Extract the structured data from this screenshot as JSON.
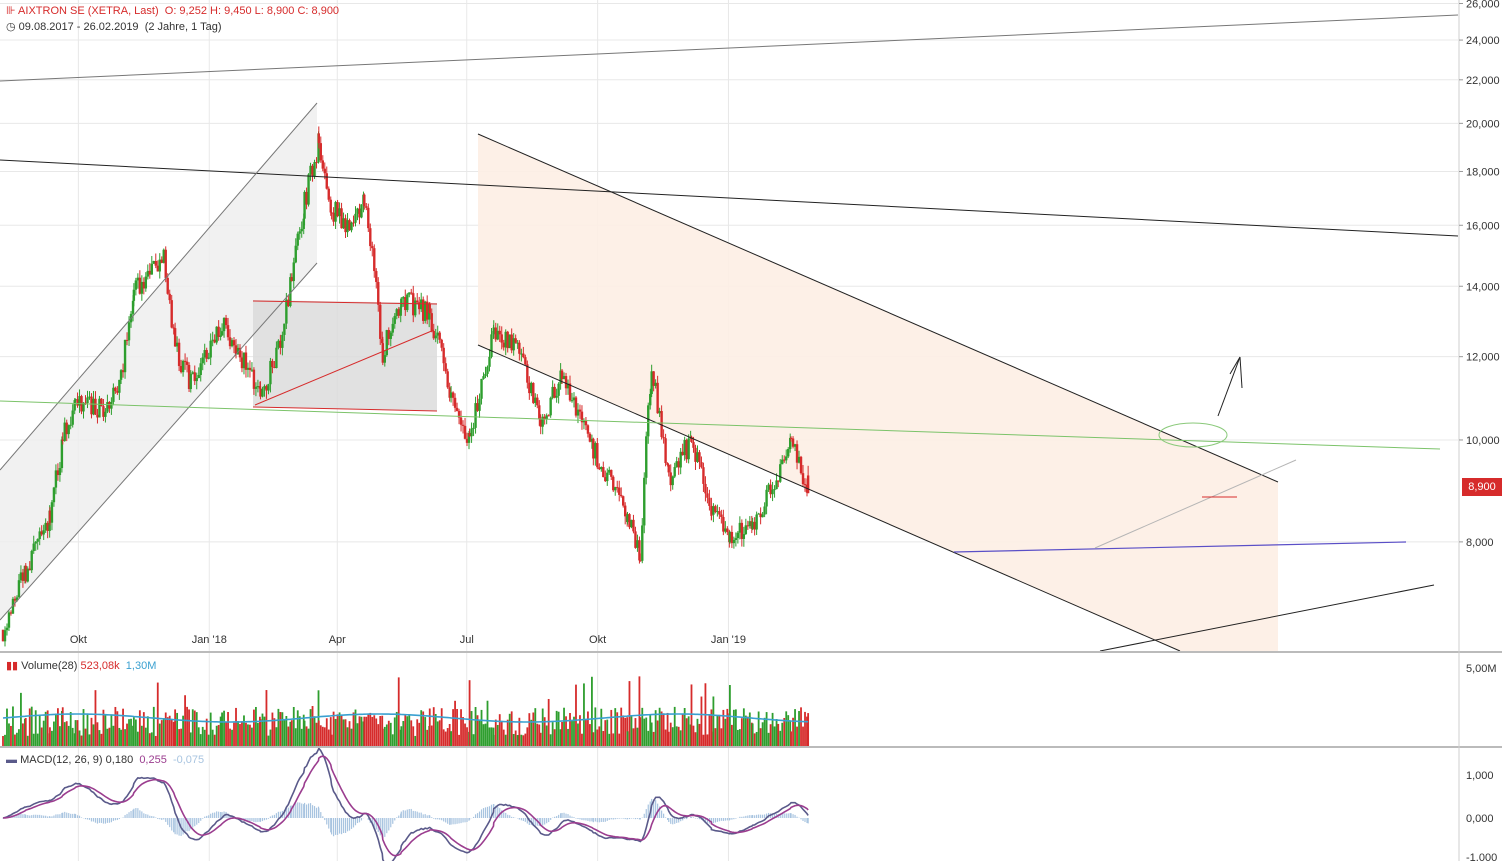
{
  "header": {
    "title": "AIXTRON SE (XETRA, Last)",
    "ohlc": "O: 9,252  H: 9,450  L: 8,900  C: 8,900",
    "range": "09.08.2017 - 26.02.2019",
    "range_note": "(2 Jahre, 1 Tag)"
  },
  "volume_legend": {
    "label": "Volume(28)",
    "value1": "523,08k",
    "value2": "1,30M"
  },
  "macd_legend": {
    "label": "MACD(12, 26, 9)",
    "macd": "0,180",
    "signal": "0,255",
    "hist": "-0,075"
  },
  "last_price_label": "8,900",
  "colors": {
    "up": "#2e9e2e",
    "down": "#d62b2b",
    "volume_ma": "#3aa0d0",
    "macd_line": "#5a5a8a",
    "signal_line": "#9b3d8f",
    "hist": "#a8c4e0",
    "channel_fill": "#fdeee4",
    "box_fill": "#d9d9d9"
  },
  "chart_data": {
    "type": "candlestick",
    "title": "AIXTRON SE (XETRA, Last)",
    "x_tick_labels": [
      "Okt",
      "Jan '18",
      "Apr",
      "Jul",
      "Okt",
      "Jan '19"
    ],
    "y_tick_labels": [
      "8,000",
      "10,000",
      "12,000",
      "14,000",
      "16,000",
      "18,000",
      "20,000",
      "22,000",
      "24,000",
      "26,000"
    ],
    "ylim": [
      6.3,
      26.2
    ],
    "y_scale": "log",
    "price_path": [
      {
        "date": "2017-08-09",
        "close": 6.6
      },
      {
        "date": "2017-08-25",
        "close": 7.5
      },
      {
        "date": "2017-09-11",
        "close": 8.4
      },
      {
        "date": "2017-09-20",
        "close": 10.0
      },
      {
        "date": "2017-09-29",
        "close": 10.9
      },
      {
        "date": "2017-10-20",
        "close": 10.7
      },
      {
        "date": "2017-10-31",
        "close": 11.4
      },
      {
        "date": "2017-11-09",
        "close": 13.9
      },
      {
        "date": "2017-11-30",
        "close": 14.8
      },
      {
        "date": "2017-12-08",
        "close": 12.2
      },
      {
        "date": "2017-12-19",
        "close": 11.3
      },
      {
        "date": "2018-01-10",
        "close": 12.9
      },
      {
        "date": "2018-02-06",
        "close": 11.0
      },
      {
        "date": "2018-02-20",
        "close": 12.4
      },
      {
        "date": "2018-02-28",
        "close": 14.3
      },
      {
        "date": "2018-03-09",
        "close": 16.8
      },
      {
        "date": "2018-03-19",
        "close": 19.2
      },
      {
        "date": "2018-03-28",
        "close": 16.6
      },
      {
        "date": "2018-04-11",
        "close": 15.8
      },
      {
        "date": "2018-04-20",
        "close": 17.0
      },
      {
        "date": "2018-05-03",
        "close": 12.1
      },
      {
        "date": "2018-05-16",
        "close": 13.6
      },
      {
        "date": "2018-06-05",
        "close": 13.2
      },
      {
        "date": "2018-06-20",
        "close": 11.0
      },
      {
        "date": "2018-07-03",
        "close": 9.9
      },
      {
        "date": "2018-07-20",
        "close": 12.7
      },
      {
        "date": "2018-08-07",
        "close": 12.1
      },
      {
        "date": "2018-08-22",
        "close": 10.4
      },
      {
        "date": "2018-09-06",
        "close": 11.5
      },
      {
        "date": "2018-09-28",
        "close": 9.8
      },
      {
        "date": "2018-10-22",
        "close": 8.4
      },
      {
        "date": "2018-10-31",
        "close": 7.8
      },
      {
        "date": "2018-11-08",
        "close": 11.7
      },
      {
        "date": "2018-11-20",
        "close": 9.2
      },
      {
        "date": "2018-12-06",
        "close": 10.0
      },
      {
        "date": "2018-12-20",
        "close": 8.5
      },
      {
        "date": "2019-01-02",
        "close": 8.1
      },
      {
        "date": "2019-01-18",
        "close": 8.3
      },
      {
        "date": "2019-02-05",
        "close": 9.3
      },
      {
        "date": "2019-02-14",
        "close": 10.0
      },
      {
        "date": "2019-02-26",
        "close": 8.9
      }
    ],
    "volume_axis_labels": [
      "5,00M"
    ],
    "macd_axis_labels": [
      "1,000",
      "0,000",
      "-1,000"
    ],
    "last": {
      "close": 8.9
    }
  }
}
